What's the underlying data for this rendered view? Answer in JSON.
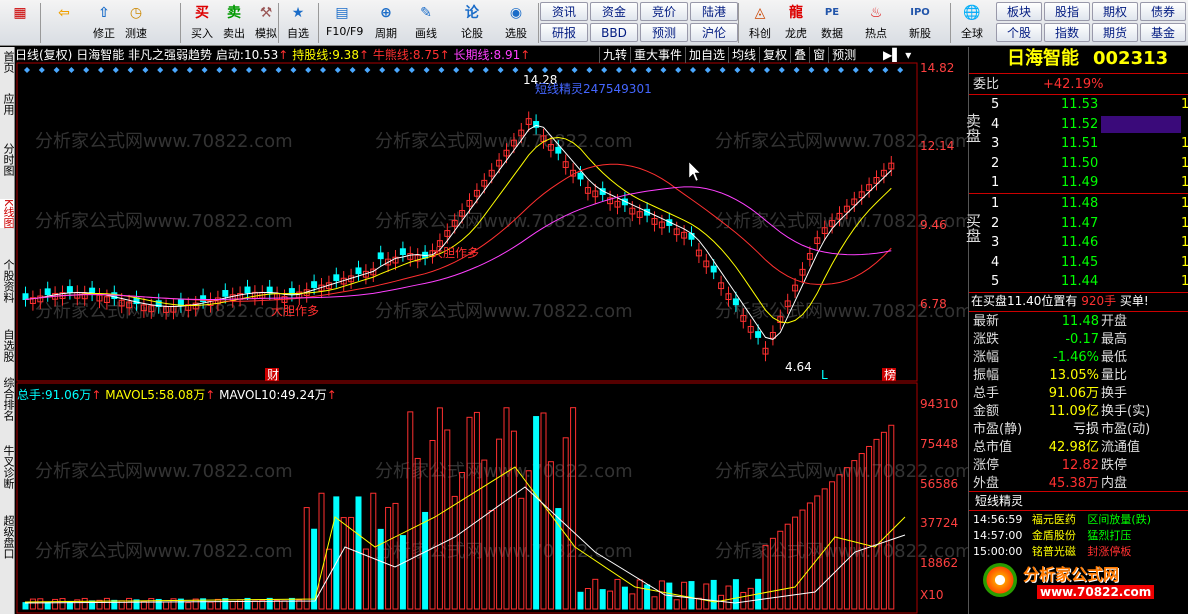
{
  "toolbar": {
    "buttons": [
      {
        "label": "",
        "icon": "grid-icon"
      },
      {
        "label": "",
        "icon": "back-arrow-icon"
      },
      {
        "label": "修正",
        "icon": "arrow-up-icon"
      },
      {
        "label": "测速",
        "icon": "clock-icon"
      },
      {
        "label": "买入",
        "icon": "buy-icon",
        "glyph": "买"
      },
      {
        "label": "卖出",
        "icon": "sell-icon",
        "glyph": "卖"
      },
      {
        "label": "模拟",
        "icon": "hammer-icon"
      },
      {
        "label": "自选",
        "icon": "star-icon"
      },
      {
        "label": "F10/F9",
        "icon": "f10-icon"
      },
      {
        "label": "周期",
        "icon": "period-icon"
      },
      {
        "label": "画线",
        "icon": "pencil-icon"
      },
      {
        "label": "论股",
        "icon": "chat-icon"
      },
      {
        "label": "选股",
        "icon": "select-stock-icon"
      }
    ],
    "grid1": [
      "资讯",
      "资金",
      "竞价",
      "陆港",
      "研报",
      "BBD",
      "预测",
      "沪伦"
    ],
    "grid2": [
      {
        "label": "龙虎",
        "icon": "dragon-icon"
      },
      {
        "label": "数据",
        "icon": "pe-icon",
        "glyph": "PE"
      },
      {
        "label": "热点",
        "icon": "hot-icon"
      },
      {
        "label": "新股",
        "icon": "ipo-icon",
        "glyph": "IPO"
      },
      {
        "label": "科创",
        "icon": "kechuang-icon"
      }
    ],
    "global_label": "全球",
    "grid3": [
      "板块",
      "股指",
      "期权",
      "债券",
      "个股",
      "指数",
      "期货",
      "基金"
    ]
  },
  "leftbar": [
    "首页",
    "应用",
    "分时图",
    "K线图",
    "个股资料",
    "自选股",
    "综合排名",
    "牛叉诊断",
    "超级盘口"
  ],
  "headline": {
    "period": "日线(复权)",
    "stock": "日海智能",
    "indicator": "非凡之强弱趋势",
    "start_label": "启动:",
    "start_value": "10.53",
    "hold_label": "持股线:",
    "hold_value": "9.38",
    "bull_label": "牛熊线:",
    "bull_value": "8.75",
    "long_label": "长期线:",
    "long_value": "8.91"
  },
  "top_buttons": [
    "九转",
    "重大事件",
    "加自选",
    "均线",
    "复权",
    "叠",
    "窗",
    "预测"
  ],
  "price_axis": [
    "14.82",
    "12.14",
    "9.46",
    "6.78"
  ],
  "volume_axis": [
    "94310",
    "75448",
    "56586",
    "37724",
    "18862"
  ],
  "volume_multiplier": "X10",
  "volume_header": {
    "total_label": "总手:",
    "total_value": "91.06万",
    "mavol5_label": "MAVOL5:",
    "mavol5_value": "58.08万",
    "mavol10_label": "MAVOL10:",
    "mavol10_value": "49.24万"
  },
  "annotations": {
    "high": "14.28",
    "low": "4.64",
    "text1": "大胆作多",
    "text2": "大胆作多",
    "text3": "短线精灵247549301",
    "marker_cai": "财",
    "marker_bang": "榜",
    "marker_l": "L"
  },
  "watermark": "分析家公式网www.70822.com",
  "right": {
    "name": "日海智能",
    "code": "002313",
    "weibi_label": "委比",
    "weibi_value": "+42.19%",
    "sell_label": "卖盘",
    "buy_label": "买盘",
    "sells": [
      {
        "n": "5",
        "p": "11.53",
        "v": "1"
      },
      {
        "n": "4",
        "p": "11.52",
        "v": ""
      },
      {
        "n": "3",
        "p": "11.51",
        "v": "1"
      },
      {
        "n": "2",
        "p": "11.50",
        "v": "1"
      },
      {
        "n": "1",
        "p": "11.49",
        "v": "1"
      }
    ],
    "buys": [
      {
        "n": "1",
        "p": "11.48",
        "v": "1"
      },
      {
        "n": "2",
        "p": "11.47",
        "v": "1"
      },
      {
        "n": "3",
        "p": "11.46",
        "v": "1"
      },
      {
        "n": "4",
        "p": "11.45",
        "v": "1"
      },
      {
        "n": "5",
        "p": "11.44",
        "v": "1"
      }
    ],
    "inbuy_text": "在买盘11.40位置有",
    "inbuy_vol": "920手",
    "inbuy_tag": "买单!",
    "stats": [
      {
        "l": "最新",
        "v": "11.48",
        "c": "green",
        "l2": "开盘",
        "v2": ""
      },
      {
        "l": "涨跌",
        "v": "-0.17",
        "c": "green",
        "l2": "最高",
        "v2": ""
      },
      {
        "l": "涨幅",
        "v": "-1.46%",
        "c": "green",
        "l2": "最低",
        "v2": ""
      },
      {
        "l": "振幅",
        "v": "13.05%",
        "c": "yellow",
        "l2": "量比",
        "v2": ""
      },
      {
        "l": "总手",
        "v": "91.06万",
        "c": "yellow",
        "l2": "换手",
        "v2": ""
      },
      {
        "l": "金额",
        "v": "11.09亿",
        "c": "yellow",
        "l2": "换手(实)",
        "v2": ""
      },
      {
        "l": "市盈(静)",
        "v": "亏损",
        "c": "white",
        "l2": "市盈(动)",
        "v2": ""
      },
      {
        "l": "总市值",
        "v": "42.98亿",
        "c": "yellow",
        "l2": "流通值",
        "v2": ""
      },
      {
        "l": "涨停",
        "v": "12.82",
        "c": "red",
        "l2": "跌停",
        "v2": ""
      },
      {
        "l": "外盘",
        "v": "45.38万",
        "c": "red",
        "l2": "内盘",
        "v2": ""
      }
    ],
    "elf_title": "短线精灵",
    "elf_rows": [
      {
        "t": "14:56:59",
        "s": "福元医药",
        "e": "区间放量(跌)",
        "c": "green"
      },
      {
        "t": "14:57:00",
        "s": "金盾股份",
        "e": "猛烈打压",
        "c": "green"
      },
      {
        "t": "15:00:00",
        "s": "铭普光磁",
        "e": "封涨停板",
        "c": "red"
      }
    ],
    "logo_text": "分析家公式网",
    "logo_url": "www.70822.com"
  }
}
